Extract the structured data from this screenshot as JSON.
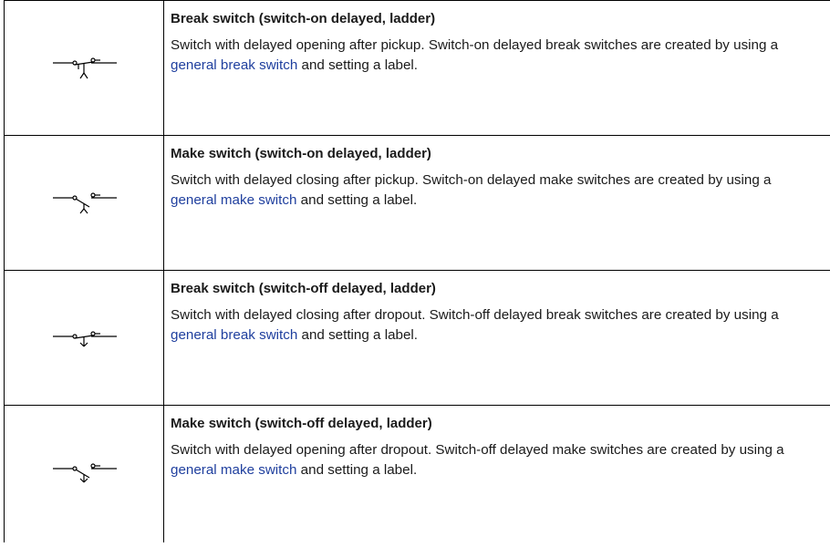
{
  "rows": [
    {
      "icon": "break-switch-on-delayed-symbol",
      "title": "Break switch (switch-on delayed, ladder)",
      "text_before": "Switch with delayed opening after pickup. Switch-on delayed break switches are created by using a ",
      "link": "general break switch",
      "text_after": " and setting a label."
    },
    {
      "icon": "make-switch-on-delayed-symbol",
      "title": "Make switch (switch-on delayed, ladder)",
      "text_before": "Switch with delayed closing after pickup. Switch-on delayed make switches are created by using a ",
      "link": "general make switch",
      "text_after": " and setting a label."
    },
    {
      "icon": "break-switch-off-delayed-symbol",
      "title": "Break switch (switch-off delayed, ladder)",
      "text_before": "Switch with delayed closing after dropout. Switch-off delayed break switches are created by using a ",
      "link": "general break switch",
      "text_after": " and setting a label."
    },
    {
      "icon": "make-switch-off-delayed-symbol",
      "title": "Make switch (switch-off delayed, ladder)",
      "text_before": "Switch with delayed opening after dropout. Switch-off delayed make switches are created by using a ",
      "link": "general make switch",
      "text_after": " and setting a label."
    }
  ],
  "colors": {
    "link": "#1f3f9e",
    "border": "#000000",
    "text": "#1a1a1a"
  }
}
